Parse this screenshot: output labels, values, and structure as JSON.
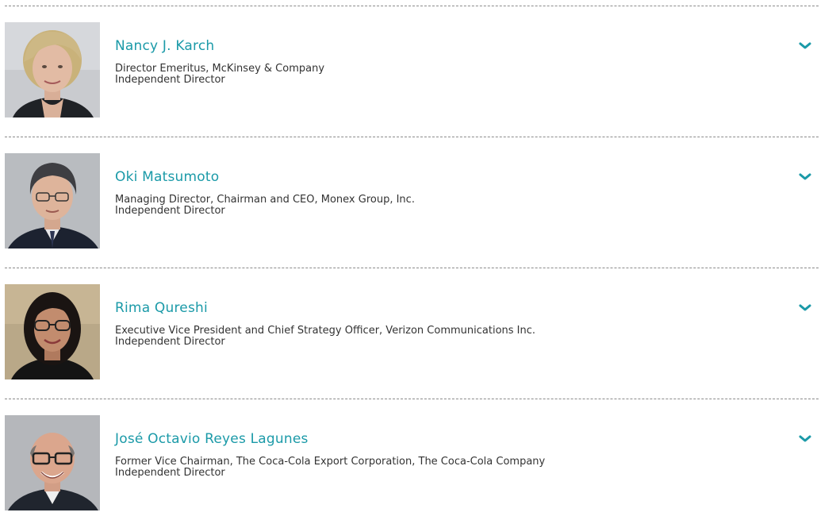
{
  "directors": [
    {
      "name": "Nancy J. Karch",
      "title": "Director Emeritus, McKinsey & Company",
      "role": "Independent Director",
      "photo_icon": "person-photo"
    },
    {
      "name": "Oki Matsumoto",
      "title": "Managing Director, Chairman and CEO, Monex Group, Inc.",
      "role": "Independent Director",
      "photo_icon": "person-photo"
    },
    {
      "name": "Rima Qureshi",
      "title": "Executive Vice President and Chief Strategy Officer, Verizon Communications Inc.",
      "role": "Independent Director",
      "photo_icon": "person-photo"
    },
    {
      "name": "José Octavio Reyes Lagunes",
      "title": "Former Vice Chairman, The Coca-Cola Export Corporation, The Coca-Cola Company",
      "role": "Independent Director",
      "photo_icon": "person-photo"
    }
  ],
  "colors": {
    "accent": "#1b9aa8",
    "text": "#333333",
    "divider": "#8a8a8a"
  },
  "icons": {
    "expand": "chevron-down-icon"
  }
}
